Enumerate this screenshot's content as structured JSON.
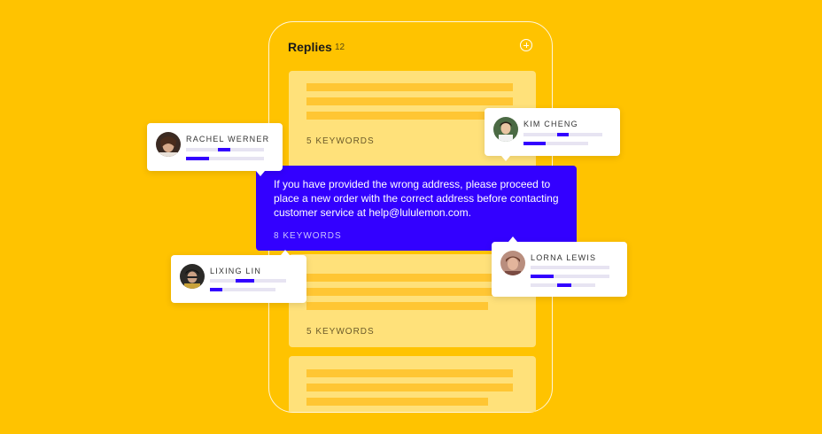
{
  "panel": {
    "title": "Replies",
    "count": "12"
  },
  "cards": [
    {
      "keywords": "5 KEYWORDS"
    },
    {
      "keywords": "5 KEYWORDS"
    }
  ],
  "highlight": {
    "message": "If you have provided the wrong address, please proceed to place a new order with the correct address before contacting customer service at help@lululemon.com.",
    "keywords": "8 KEYWORDS"
  },
  "users": [
    {
      "name": "RACHEL WERNER",
      "avatar": "avatar-rachel-werner"
    },
    {
      "name": "KIM CHENG",
      "avatar": "avatar-kim-cheng"
    },
    {
      "name": "LIXING LIN",
      "avatar": "avatar-lixing-lin"
    },
    {
      "name": "LORNA LEWIS",
      "avatar": "avatar-lorna-lewis"
    }
  ],
  "colors": {
    "background": "#FFC300",
    "accent": "#3300FF",
    "card": "#FFE17A",
    "card_line": "#FFC633",
    "white": "#FFFFFF"
  }
}
